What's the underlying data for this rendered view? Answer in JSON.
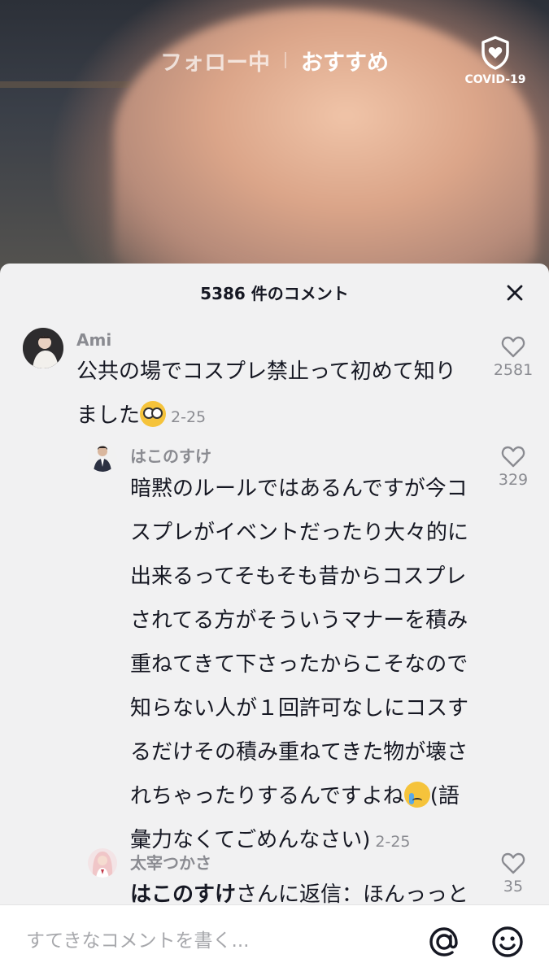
{
  "top_tabs": {
    "following": "フォロー中",
    "for_you": "おすすめ"
  },
  "covid": {
    "label": "COVID-19",
    "icon": "shield-heart-icon"
  },
  "comments_sheet": {
    "title": "5386 件のコメント",
    "comments": [
      {
        "username": "Ami",
        "line1": "公共の場でコスプレ禁止って初めて知り",
        "line2": "ました",
        "emoji": "flushed-face-emoji",
        "date": "2-25",
        "likes": "2581"
      },
      {
        "username": "はこのすけ",
        "lines": [
          "暗黙のルールではあるんですが今コ",
          "スプレがイベントだったり大々的に",
          "出来るってそもそも昔からコスプレ",
          "されてる方がそういうマナーを積み",
          "重ねてきて下さったからこそなので",
          "知らない人が１回許可なしにコスす",
          "るだけその積み重ねてきた物が壊さ"
        ],
        "line8": "れちゃったりするんですよね",
        "line8_suffix": "(語",
        "line9": "彙力なくてごめんなさい)",
        "emoji": "crying-face-emoji",
        "date": "2-25",
        "likes": "329"
      },
      {
        "username": "太宰つかさ",
        "reply_to": "はこのすけ",
        "text": "さんに返信：ほんっっと",
        "likes": "35"
      }
    ]
  },
  "input_bar": {
    "placeholder": "すてきなコメントを書く..."
  }
}
